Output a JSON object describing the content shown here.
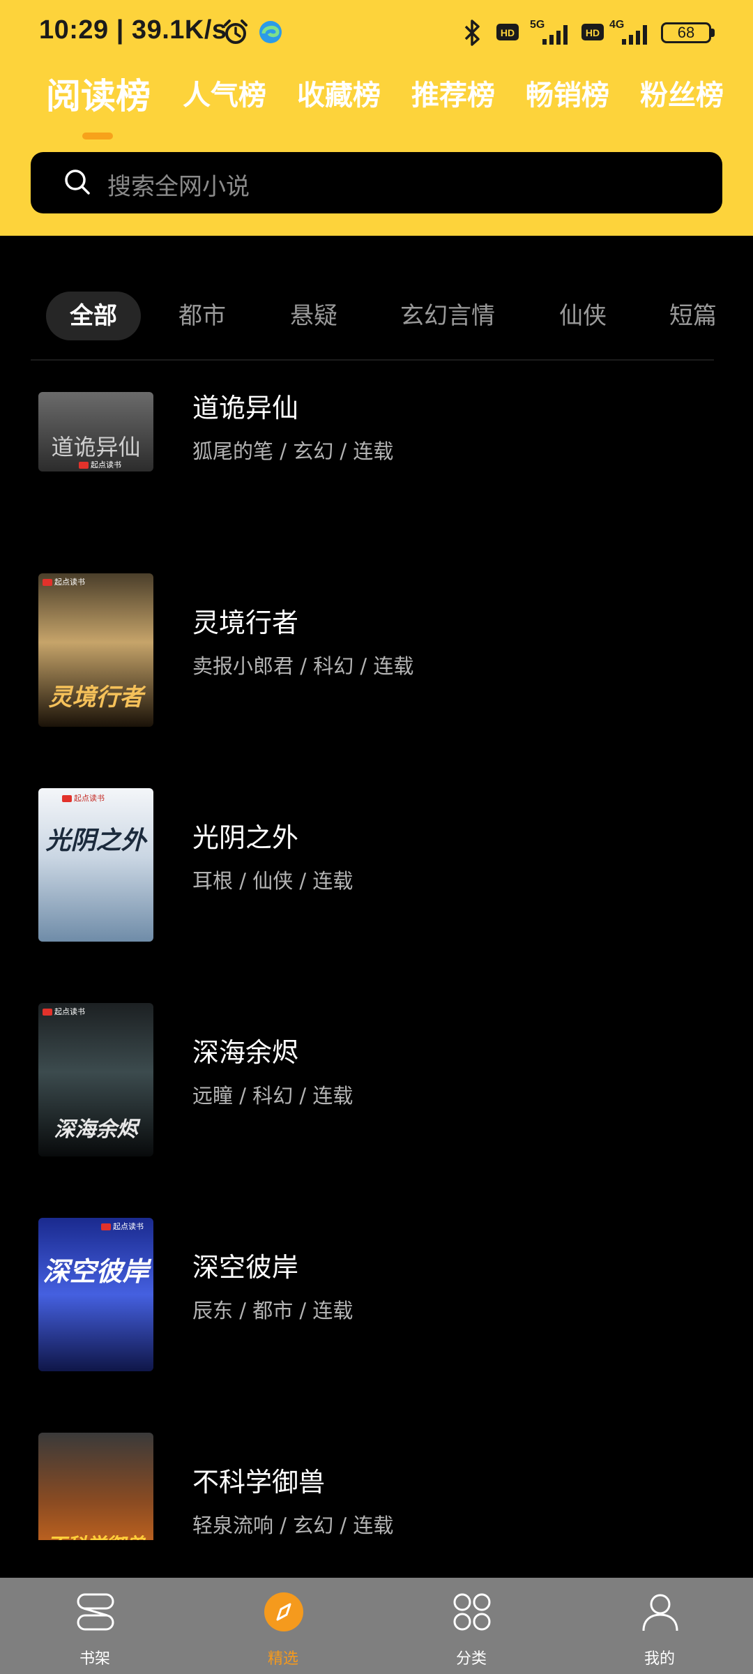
{
  "status_bar": {
    "time_speed": "10:29 | 39.1K/s",
    "battery": "68",
    "network_5g": "5G",
    "network_4g": "4G",
    "hd": "HD"
  },
  "ranking_tabs": [
    {
      "label": "阅读榜",
      "active": true
    },
    {
      "label": "人气榜"
    },
    {
      "label": "收藏榜"
    },
    {
      "label": "推荐榜"
    },
    {
      "label": "畅销榜"
    },
    {
      "label": "粉丝榜"
    }
  ],
  "search": {
    "placeholder": "搜索全网小说"
  },
  "categories": [
    {
      "label": "全部",
      "active": true
    },
    {
      "label": "都市"
    },
    {
      "label": "悬疑"
    },
    {
      "label": "玄幻言情"
    },
    {
      "label": "仙侠"
    },
    {
      "label": "短篇"
    }
  ],
  "books": [
    {
      "title": "道诡异仙",
      "meta": "狐尾的笔 / 玄幻 / 连载",
      "cover_text": "道诡异仙",
      "cover_colors": [
        "#5a5a5a",
        "#2a2a2a"
      ]
    },
    {
      "title": "灵境行者",
      "meta": "卖报小郎君 / 科幻 / 连载",
      "cover_text": "灵境行者",
      "cover_colors": [
        "#3b3326",
        "#1a1208"
      ]
    },
    {
      "title": "光阴之外",
      "meta": "耳根 / 仙侠 / 连载",
      "cover_text": "光阴之外",
      "cover_colors": [
        "#e9eef5",
        "#7f9bb8"
      ]
    },
    {
      "title": "深海余烬",
      "meta": "远瞳 / 科幻 / 连载",
      "cover_text": "深海余烬",
      "cover_colors": [
        "#2f3a3c",
        "#0c1012"
      ]
    },
    {
      "title": "深空彼岸",
      "meta": "辰东 / 都市 / 连载",
      "cover_text": "深空彼岸",
      "cover_colors": [
        "#3a4fd4",
        "#111a55"
      ]
    },
    {
      "title": "不科学御兽",
      "meta": "轻泉流响 / 玄幻 / 连载",
      "cover_text": "不科学御兽",
      "cover_colors": [
        "#8a4b22",
        "#2a1a10"
      ]
    }
  ],
  "cover_badge": "起点读书",
  "bottom_nav": [
    {
      "label": "书架",
      "icon": "bookshelf-icon"
    },
    {
      "label": "精选",
      "icon": "compass-icon",
      "active": true
    },
    {
      "label": "分类",
      "icon": "category-grid-icon"
    },
    {
      "label": "我的",
      "icon": "profile-icon"
    }
  ],
  "colors": {
    "header_bg": "#FDD33B",
    "accent": "#F59A1D",
    "page_bg": "#000000",
    "nav_bg": "#7F7F7F"
  }
}
